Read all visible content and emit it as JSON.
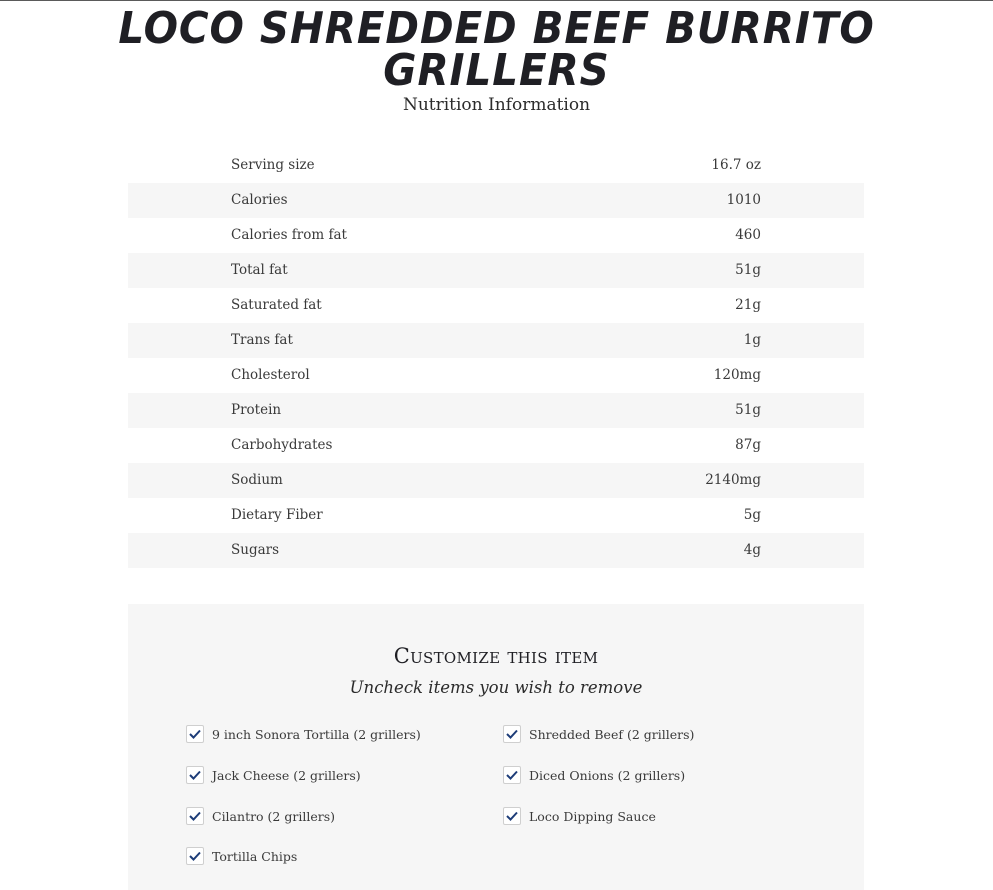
{
  "header": {
    "title": "LOCO SHREDDED BEEF BURRITO GRILLERS",
    "subtitle": "Nutrition Information"
  },
  "nutrition": {
    "rows": [
      {
        "label": "Serving size",
        "value": "16.7 oz"
      },
      {
        "label": "Calories",
        "value": "1010"
      },
      {
        "label": "Calories from fat",
        "value": "460"
      },
      {
        "label": "Total fat",
        "value": "51g"
      },
      {
        "label": "Saturated fat",
        "value": "21g"
      },
      {
        "label": "Trans fat",
        "value": "1g"
      },
      {
        "label": "Cholesterol",
        "value": "120mg"
      },
      {
        "label": "Protein",
        "value": "51g"
      },
      {
        "label": "Carbohydrates",
        "value": "87g"
      },
      {
        "label": "Sodium",
        "value": "2140mg"
      },
      {
        "label": "Dietary Fiber",
        "value": "5g"
      },
      {
        "label": "Sugars",
        "value": "4g"
      }
    ]
  },
  "customize": {
    "title": "Customize this item",
    "subtitle": "Uncheck items you wish to remove",
    "options": [
      {
        "label": "9 inch Sonora Tortilla (2 grillers)",
        "checked": true
      },
      {
        "label": "Shredded Beef (2 grillers)",
        "checked": true
      },
      {
        "label": "Jack Cheese (2 grillers)",
        "checked": true
      },
      {
        "label": "Diced Onions (2 grillers)",
        "checked": true
      },
      {
        "label": "Cilantro (2 grillers)",
        "checked": true
      },
      {
        "label": "Loco Dipping Sauce",
        "checked": true
      },
      {
        "label": "Tortilla Chips",
        "checked": true
      }
    ]
  },
  "colors": {
    "checkmark": "#1d3c78",
    "row_alt_bg": "#f6f6f6",
    "title_text": "#1f1f24"
  },
  "icons": {
    "checkbox": "checkmark-icon"
  }
}
